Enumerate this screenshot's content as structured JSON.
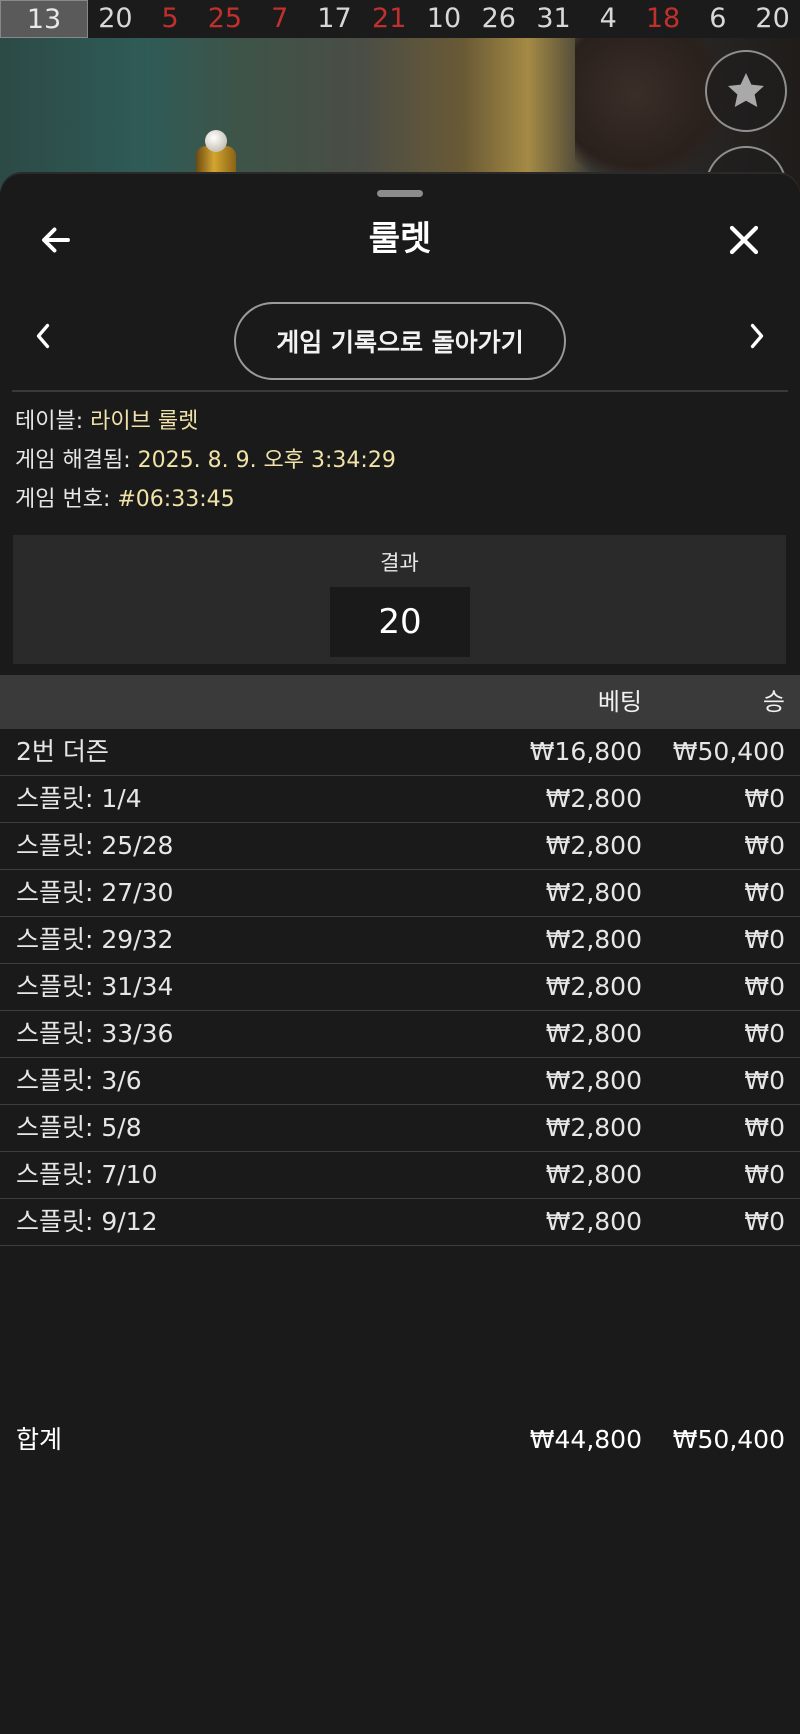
{
  "history": [
    {
      "n": "13",
      "color": "first"
    },
    {
      "n": "20",
      "color": "black"
    },
    {
      "n": "5",
      "color": "red"
    },
    {
      "n": "25",
      "color": "red"
    },
    {
      "n": "7",
      "color": "red"
    },
    {
      "n": "17",
      "color": "black"
    },
    {
      "n": "21",
      "color": "red"
    },
    {
      "n": "10",
      "color": "black"
    },
    {
      "n": "26",
      "color": "black"
    },
    {
      "n": "31",
      "color": "black"
    },
    {
      "n": "4",
      "color": "black"
    },
    {
      "n": "18",
      "color": "red"
    },
    {
      "n": "6",
      "color": "black"
    },
    {
      "n": "20",
      "color": "black"
    }
  ],
  "sheet": {
    "title": "룰렛",
    "history_back_label": "게임 기록으로 돌아가기"
  },
  "info": {
    "table_label": "테이블: ",
    "table_value": "라이브 룰렛",
    "resolved_label": "게임 해결됨: ",
    "resolved_value": "2025. 8. 9. 오후 3:34:29",
    "game_no_label": "게임 번호: ",
    "game_no_value": "#06:33:45"
  },
  "result": {
    "label": "결과",
    "value": "20"
  },
  "table": {
    "bet_header": "베팅",
    "win_header": "승",
    "rows": [
      {
        "name": "2번 더즌",
        "bet": "₩16,800",
        "win": "₩50,400"
      },
      {
        "name": "스플릿: 1/4",
        "bet": "₩2,800",
        "win": "₩0"
      },
      {
        "name": "스플릿: 25/28",
        "bet": "₩2,800",
        "win": "₩0"
      },
      {
        "name": "스플릿: 27/30",
        "bet": "₩2,800",
        "win": "₩0"
      },
      {
        "name": "스플릿: 29/32",
        "bet": "₩2,800",
        "win": "₩0"
      },
      {
        "name": "스플릿: 31/34",
        "bet": "₩2,800",
        "win": "₩0"
      },
      {
        "name": "스플릿: 33/36",
        "bet": "₩2,800",
        "win": "₩0"
      },
      {
        "name": "스플릿: 3/6",
        "bet": "₩2,800",
        "win": "₩0"
      },
      {
        "name": "스플릿: 5/8",
        "bet": "₩2,800",
        "win": "₩0"
      },
      {
        "name": "스플릿: 7/10",
        "bet": "₩2,800",
        "win": "₩0"
      },
      {
        "name": "스플릿: 9/12",
        "bet": "₩2,800",
        "win": "₩0"
      }
    ],
    "total": {
      "name": "합계",
      "bet": "₩44,800",
      "win": "₩50,400"
    }
  },
  "colors": {
    "red_number": "#c0302c",
    "info_value": "#f0e2a8",
    "sheet_bg": "#1a1a1a",
    "header_bg": "#3a3a3a"
  },
  "icons": {
    "favorite": "star-icon",
    "back": "arrow-left-icon",
    "close": "close-icon",
    "prev": "chevron-left-icon",
    "next": "chevron-right-icon"
  }
}
